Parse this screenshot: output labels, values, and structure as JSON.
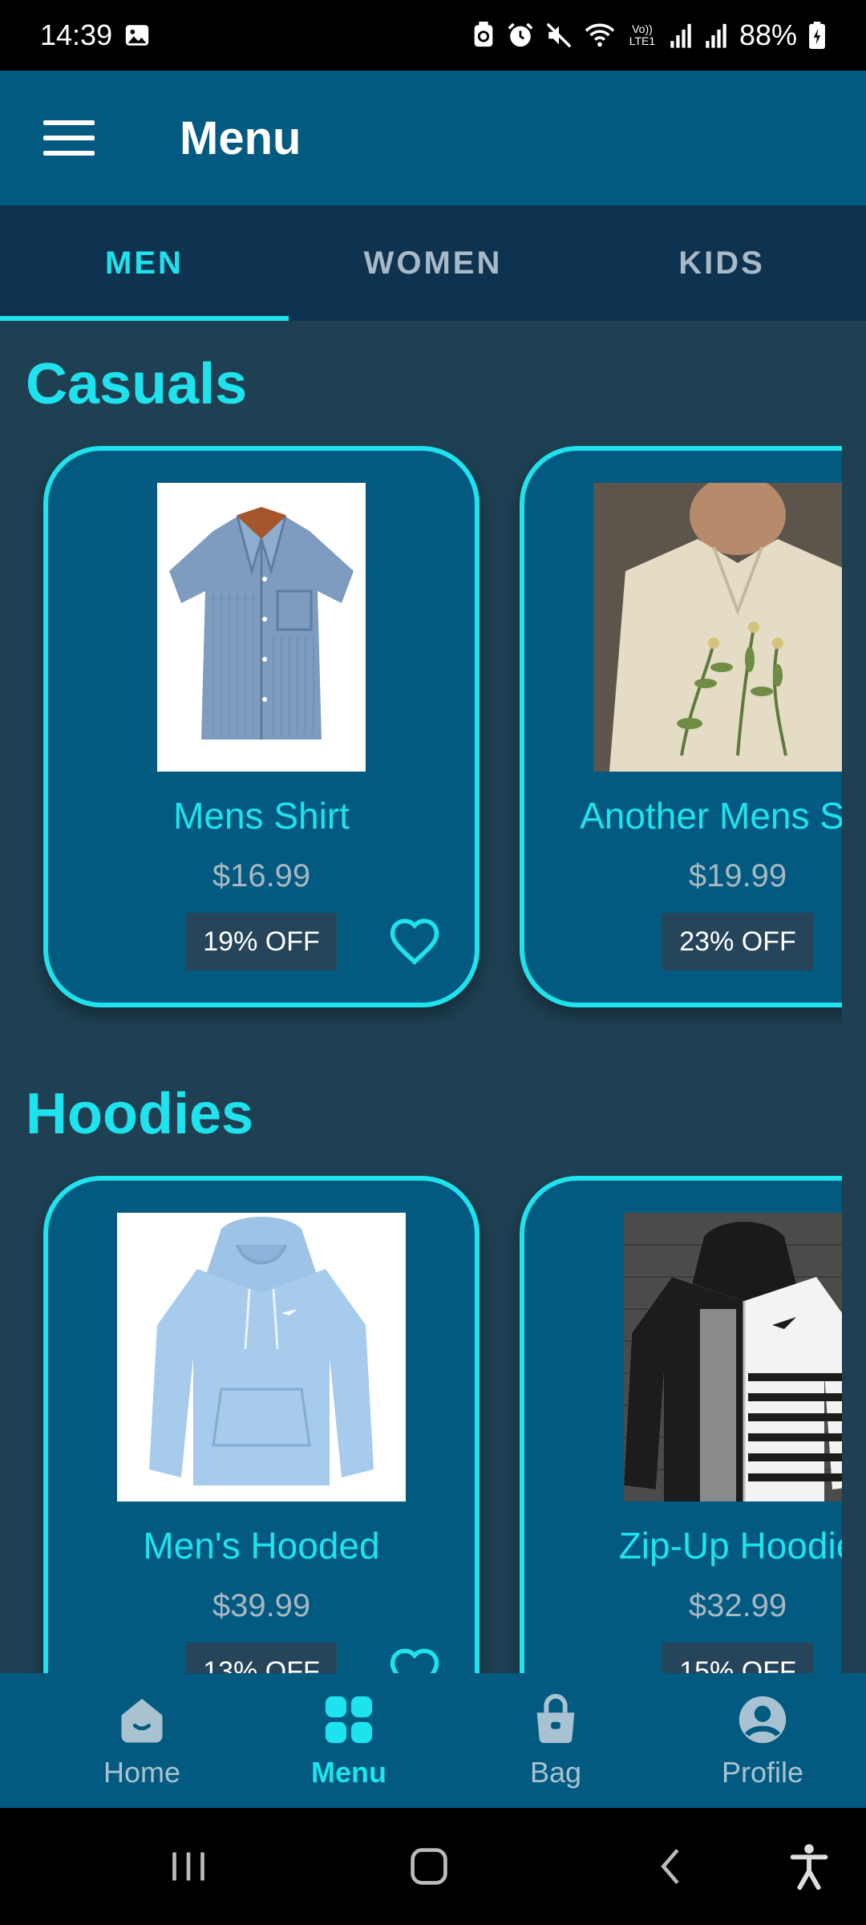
{
  "status_bar": {
    "time": "14:39",
    "battery": "88%",
    "icons": [
      "image-icon",
      "backup-icon",
      "alarm-icon",
      "mute-icon",
      "wifi-icon",
      "volte-icon",
      "signal-icon",
      "signal-icon",
      "battery-charging-icon"
    ],
    "volte_text": "Vo)) LTE1"
  },
  "app_bar": {
    "title": "Menu",
    "menu_icon": "hamburger-icon"
  },
  "tabs": [
    {
      "label": "MEN",
      "active": true
    },
    {
      "label": "WOMEN",
      "active": false
    },
    {
      "label": "KIDS",
      "active": false
    }
  ],
  "sections": [
    {
      "title": "Casuals",
      "products": [
        {
          "name": "Mens Shirt",
          "price": "$16.99",
          "discount": "19% OFF",
          "image": "blue-short-sleeve-shirt",
          "favorite_icon": "heart-outline-icon"
        },
        {
          "name": "Another Mens Shirt",
          "price": "$19.99",
          "discount": "23% OFF",
          "image": "floral-embroidered-linen-shirt"
        }
      ]
    },
    {
      "title": "Hoodies",
      "products": [
        {
          "name": "Men's Hooded",
          "price": "$39.99",
          "discount": "13% OFF",
          "image": "light-blue-hoodie",
          "favorite_icon": "heart-outline-icon"
        },
        {
          "name": "Zip-Up Hoodie",
          "price": "$32.99",
          "discount": "15% OFF",
          "image": "black-white-striped-zip-hoodie"
        }
      ]
    }
  ],
  "bottom_nav": [
    {
      "label": "Home",
      "icon": "home-icon",
      "active": false
    },
    {
      "label": "Menu",
      "icon": "grid-icon",
      "active": true
    },
    {
      "label": "Bag",
      "icon": "shopping-bag-icon",
      "active": false
    },
    {
      "label": "Profile",
      "icon": "account-circle-icon",
      "active": false
    }
  ],
  "colors": {
    "accent": "#1ee3ee",
    "app_bar": "#035a80",
    "tab_bar": "#0e3350",
    "background": "#1e4052",
    "card": "#035a80",
    "badge": "#26455a",
    "price": "#a9b7c2"
  }
}
